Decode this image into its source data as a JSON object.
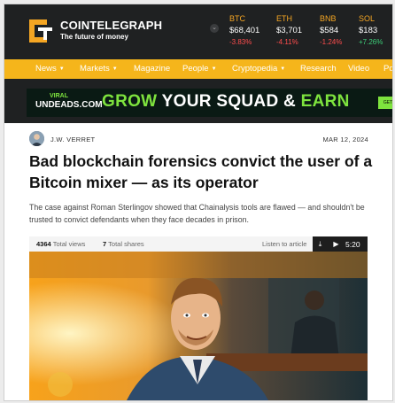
{
  "brand": {
    "name": "COINTELEGRAPH",
    "tagline": "The future of money"
  },
  "ticker": [
    {
      "symbol": "BTC",
      "price": "$68,401",
      "change": "-3.83%",
      "direction": "down"
    },
    {
      "symbol": "ETH",
      "price": "$3,701",
      "change": "-4.11%",
      "direction": "down"
    },
    {
      "symbol": "BNB",
      "price": "$584",
      "change": "-1.24%",
      "direction": "down"
    },
    {
      "symbol": "SOL",
      "price": "$183",
      "change": "+7.26%",
      "direction": "up"
    }
  ],
  "nav": [
    {
      "label": "News",
      "dropdown": true
    },
    {
      "label": "Markets",
      "dropdown": true
    },
    {
      "label": "Magazine",
      "dropdown": false
    },
    {
      "label": "People",
      "dropdown": true
    },
    {
      "label": "Cryptopedia",
      "dropdown": true
    },
    {
      "label": "Research",
      "dropdown": false
    },
    {
      "label": "Video",
      "dropdown": false
    },
    {
      "label": "Pd",
      "dropdown": false
    }
  ],
  "ad": {
    "logo_top": "VIRAL",
    "logo_main": "UNDEADS.COM",
    "text_part1": "GROW",
    "text_part2": "YOUR SQUAD &",
    "text_part3": "EARN",
    "button": "GET"
  },
  "article": {
    "author": "J.W. VERRET",
    "date": "MAR 12, 2024",
    "title": "Bad blockchain forensics convict the user of a Bitcoin mixer — as its operator",
    "lead": "The case against Roman Sterlingov showed that Chainalysis tools are flawed — and shouldn't be trusted to convict defendants when they face decades in prison."
  },
  "stats": {
    "views": "4364",
    "views_label": "Total views",
    "shares": "7",
    "shares_label": "Total shares",
    "listen_label": "Listen to article",
    "duration": "5:20"
  },
  "colors": {
    "header_bg": "#1f2122",
    "nav_bg": "#f5b51b",
    "accent": "#f5a623",
    "negative": "#ff4d4d",
    "positive": "#3ed07a",
    "ad_green": "#7ee33e"
  },
  "icons": {
    "logo": "cointelegraph-logo-icon",
    "download": "download-icon",
    "play": "play-icon"
  }
}
